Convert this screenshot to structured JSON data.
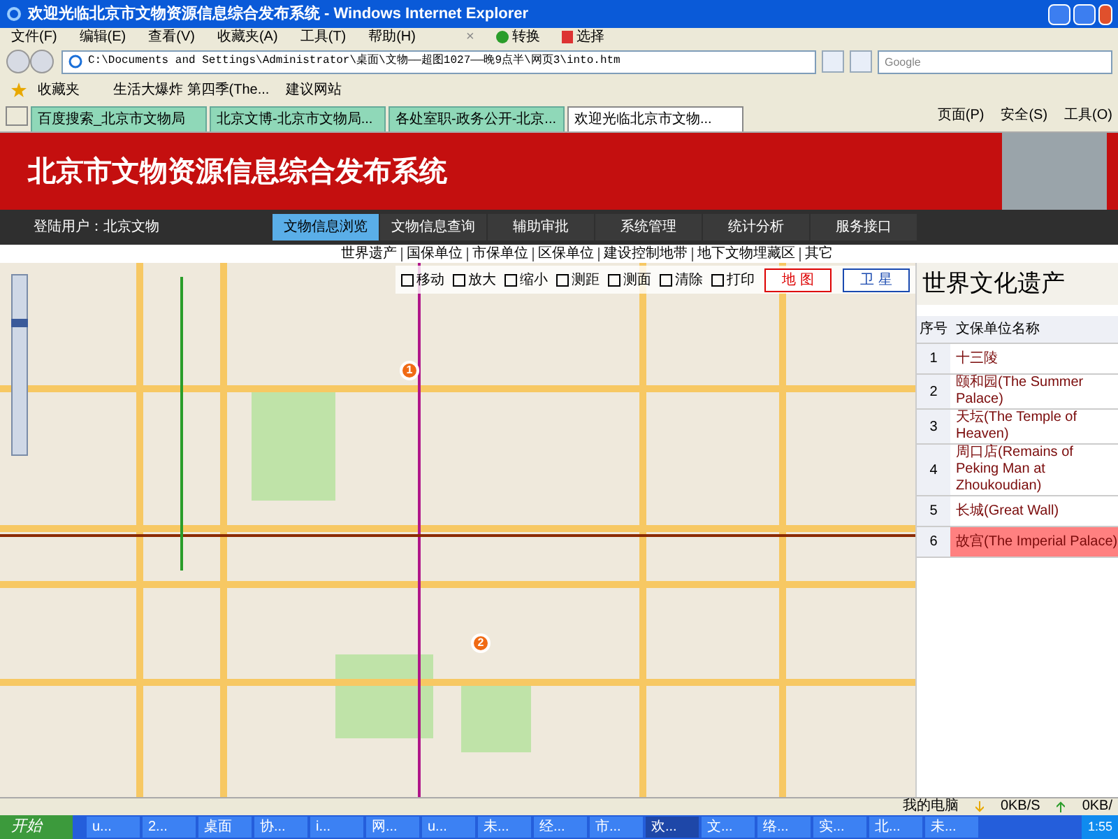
{
  "window": {
    "title": "欢迎光临北京市文物资源信息综合发布系统 - Windows Internet Explorer"
  },
  "menu": [
    "文件(F)",
    "编辑(E)",
    "查看(V)",
    "收藏夹(A)",
    "工具(T)",
    "帮助(H)"
  ],
  "menu_tools": [
    {
      "label": "×",
      "kind": "close"
    },
    {
      "label": "转换",
      "kind": "convert"
    },
    {
      "label": "选择",
      "kind": "select"
    }
  ],
  "address": {
    "value": "C:\\Documents and Settings\\Administrator\\桌面\\文物——超图1027——晚9点半\\网页3\\into.htm"
  },
  "search": {
    "placeholder": "Google"
  },
  "favorites_bar": {
    "label": "收藏夹",
    "items": [
      "生活大爆炸 第四季(The...",
      "建议网站"
    ]
  },
  "tabs": [
    {
      "label": "百度搜索_北京市文物局",
      "selected": false
    },
    {
      "label": "北京文博-北京市文物局...",
      "selected": false
    },
    {
      "label": "各处室职-政务公开-北京...",
      "selected": false
    },
    {
      "label": "欢迎光临北京市文物...",
      "selected": true
    }
  ],
  "command_bar": [
    "页面(P)",
    "安全(S)",
    "工具(O)"
  ],
  "page": {
    "title": "北京市文物资源信息综合发布系统",
    "user": "登陆用户：北京文物",
    "nav": [
      {
        "label": "文物信息浏览",
        "selected": true
      },
      {
        "label": "文物信息查询",
        "selected": false
      },
      {
        "label": "辅助审批",
        "selected": false
      },
      {
        "label": "系统管理",
        "selected": false
      },
      {
        "label": "统计分析",
        "selected": false
      },
      {
        "label": "服务接口",
        "selected": false
      }
    ],
    "categories": [
      "世界遗产",
      "国保单位",
      "市保单位",
      "区保单位",
      "建设控制地带",
      "地下文物埋藏区",
      "其它"
    ],
    "map_tools": [
      "移动",
      "放大",
      "缩小",
      "测距",
      "测面",
      "清除",
      "打印"
    ],
    "map_types": [
      {
        "label": "地 图",
        "selected": true
      },
      {
        "label": "卫 星",
        "selected": false
      }
    ],
    "zoom_slider": {
      "level": 0.75
    },
    "pins": [
      "1",
      "2"
    ],
    "panel": {
      "title": "世界文化遗产",
      "columns": [
        "序号",
        "文保单位名称"
      ],
      "rows": [
        {
          "no": "1",
          "name": "十三陵",
          "selected": false
        },
        {
          "no": "2",
          "name": "颐和园(The Summer Palace)",
          "selected": false
        },
        {
          "no": "3",
          "name": "天坛(The Temple of Heaven)",
          "selected": false
        },
        {
          "no": "4",
          "name": "周口店(Remains of Peking Man at Zhoukoudian)",
          "selected": false
        },
        {
          "no": "5",
          "name": "长城(Great Wall)",
          "selected": false
        },
        {
          "no": "6",
          "name": "故宫(The Imperial Palace)",
          "selected": true
        }
      ]
    }
  },
  "status_bar": {
    "zone": "我的电脑",
    "down": "0KB/S",
    "up": "0KB/"
  },
  "taskbar": {
    "start": "开始",
    "tasks": [
      {
        "label": "u...",
        "selected": false
      },
      {
        "label": "2...",
        "selected": false
      },
      {
        "label": "桌面",
        "selected": false
      },
      {
        "label": "协...",
        "selected": false
      },
      {
        "label": "i...",
        "selected": false
      },
      {
        "label": "网...",
        "selected": false
      },
      {
        "label": "u...",
        "selected": false
      },
      {
        "label": "未...",
        "selected": false
      },
      {
        "label": "经...",
        "selected": false
      },
      {
        "label": "市...",
        "selected": false
      },
      {
        "label": "欢...",
        "selected": true
      },
      {
        "label": "文...",
        "selected": false
      },
      {
        "label": "络...",
        "selected": false
      },
      {
        "label": "实...",
        "selected": false
      },
      {
        "label": "北...",
        "selected": false
      },
      {
        "label": "未...",
        "selected": false
      }
    ],
    "time": "1:55"
  }
}
